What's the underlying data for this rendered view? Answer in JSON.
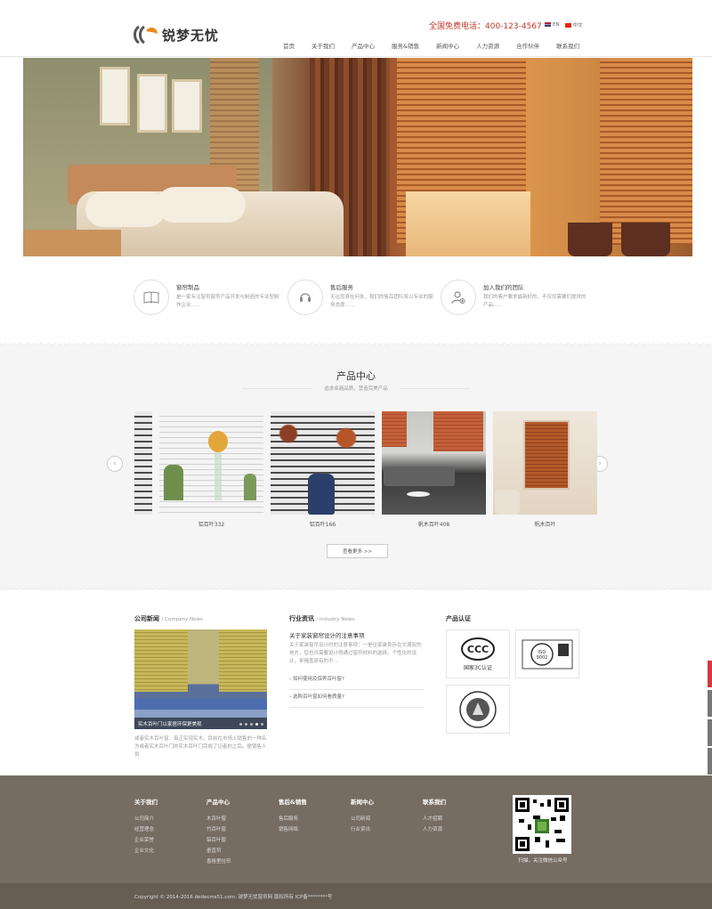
{
  "header": {
    "logo_text": "锐梦无忧",
    "hotline": "全国免费电话：400-123-4567",
    "lang_en": "EN",
    "lang_cn": "中文",
    "nav": [
      "首页",
      "关于我们",
      "产品中心",
      "服务&销售",
      "新闻中心",
      "人力资源",
      "合作伙伴",
      "联系我们"
    ]
  },
  "features": [
    {
      "title": "窗帘制品",
      "desc": "是一家专注窗帘窗帘产品开发与制造的专业型制作企业......",
      "icon": "book-icon"
    },
    {
      "title": "售后服务",
      "desc": "无论您身在何处，我们的售后团队将以专业的服务态度......",
      "icon": "headset-icon"
    },
    {
      "title": "加入我们的团队",
      "desc": "我们的客户要求最新好的，不仅仅需要们提供的产品......",
      "icon": "user-add-icon"
    }
  ],
  "products": {
    "title": "产品中心",
    "subtitle": "追求卓越品质，营造完美产品",
    "items": [
      {
        "name": "铝百叶332"
      },
      {
        "name": "铝百叶166"
      },
      {
        "name": "帆木百叶408"
      },
      {
        "name": "帆木百叶"
      }
    ],
    "more_button": "查看更多 >>"
  },
  "news": {
    "company_title": "公司新闻",
    "company_en": "/ Company News",
    "photo_caption": "实木百叶门以家居环保更美观",
    "summary": "或者实木百叶窗、真正实现实木。目前在市场上销售的一种名为或者实木百叶门的实木百叶门完成了记者的之后。便销售人员",
    "industry_title": "行业资讯",
    "industry_en": "/ Industry News",
    "industry_headline": "关于家装窗帘设计的注意事项",
    "industry_desc": "关于家装窗帘设计时的注意事项：一是往家装免存在文满双的地方，您也许需要设计得通过窗帘材料的选择，个性化的设计，来掩盖原有的不...",
    "links": [
      "如何使用及保养百叶窗?",
      "选购百叶窗如何看质量?"
    ],
    "cert_title": "产品认证",
    "cert_3c": "国家3C认证"
  },
  "footer": {
    "columns": [
      {
        "title": "关于我们",
        "links": [
          "公司简介",
          "经营理念",
          "企业荣誉",
          "企业文化"
        ]
      },
      {
        "title": "产品中心",
        "links": [
          "木百叶窗",
          "竹百叶窗",
          "铝百叶窗",
          "垂直帘",
          "香格里拉帘"
        ]
      },
      {
        "title": "售后&销售",
        "links": [
          "售后服务",
          "销售网络"
        ]
      },
      {
        "title": "新闻中心",
        "links": [
          "公司新闻",
          "行业资讯"
        ]
      },
      {
        "title": "联系我们",
        "links": [
          "人才招聘",
          "人力资源"
        ]
      }
    ],
    "qr_caption": "扫描，关注微信公众号",
    "copyright": "Copyright © 2014-2016 dedecms51.com. 锐梦无忧窗帘网 版权所有    ICP备********号"
  }
}
